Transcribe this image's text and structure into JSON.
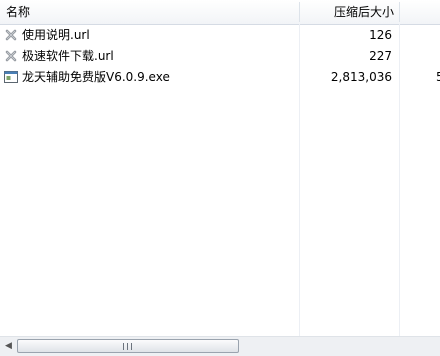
{
  "columns": {
    "name": "名称",
    "size": "压缩后大小"
  },
  "files": [
    {
      "name": "使用说明.url",
      "size": "126",
      "clip": "",
      "icon": "broken-url-icon"
    },
    {
      "name": "极速软件下载.url",
      "size": "227",
      "clip": "",
      "icon": "broken-url-icon"
    },
    {
      "name": "龙天辅助免费版V6.0.9.exe",
      "size": "2,813,036",
      "clip": "5",
      "icon": "exe-window-icon"
    }
  ],
  "scrollbar": {
    "left_arrow": "◀",
    "grip": ""
  },
  "colors": {
    "header_border": "#d5dbe4",
    "thumb_border": "#9aa3ae"
  }
}
